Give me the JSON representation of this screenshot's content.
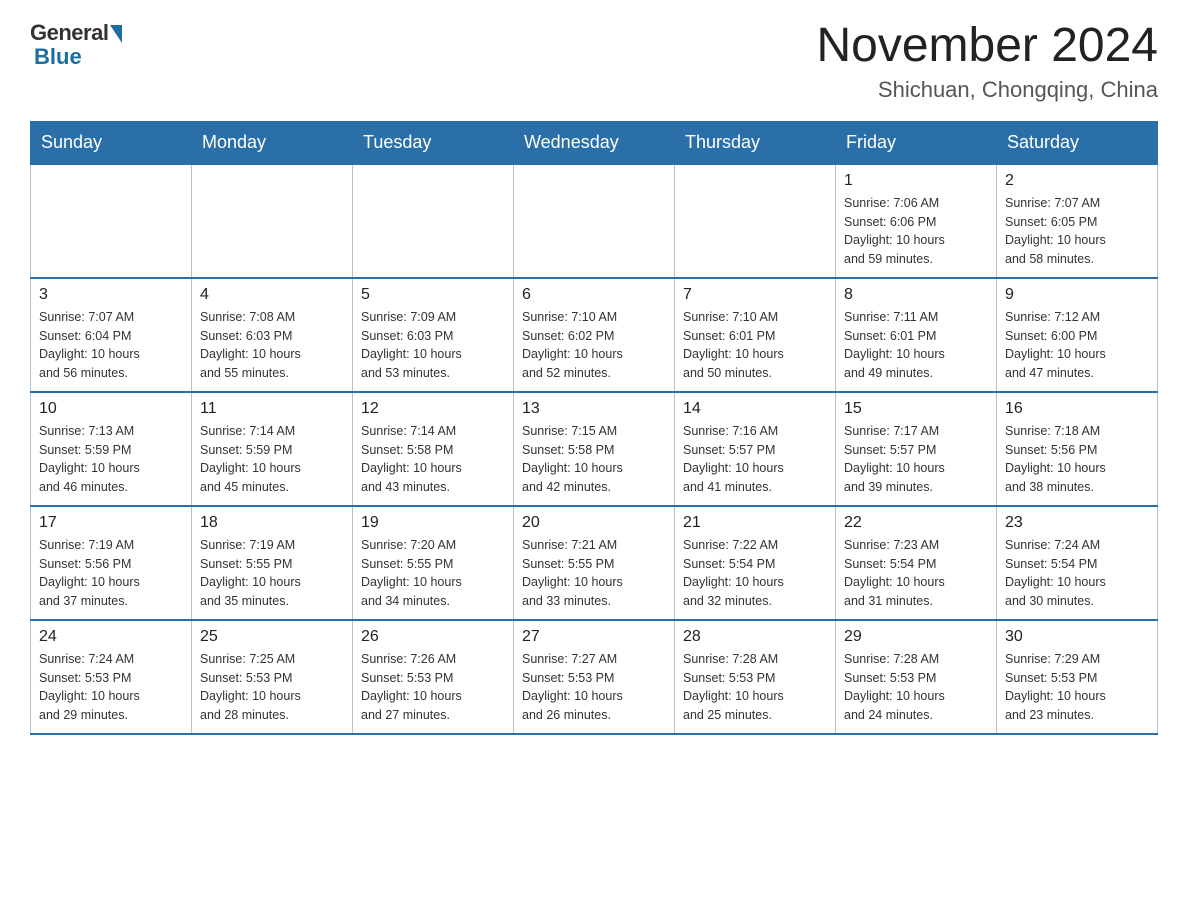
{
  "logo": {
    "general": "General",
    "blue": "Blue"
  },
  "header": {
    "title": "November 2024",
    "location": "Shichuan, Chongqing, China"
  },
  "days_of_week": [
    "Sunday",
    "Monday",
    "Tuesday",
    "Wednesday",
    "Thursday",
    "Friday",
    "Saturday"
  ],
  "weeks": [
    [
      {
        "day": "",
        "info": ""
      },
      {
        "day": "",
        "info": ""
      },
      {
        "day": "",
        "info": ""
      },
      {
        "day": "",
        "info": ""
      },
      {
        "day": "",
        "info": ""
      },
      {
        "day": "1",
        "info": "Sunrise: 7:06 AM\nSunset: 6:06 PM\nDaylight: 10 hours\nand 59 minutes."
      },
      {
        "day": "2",
        "info": "Sunrise: 7:07 AM\nSunset: 6:05 PM\nDaylight: 10 hours\nand 58 minutes."
      }
    ],
    [
      {
        "day": "3",
        "info": "Sunrise: 7:07 AM\nSunset: 6:04 PM\nDaylight: 10 hours\nand 56 minutes."
      },
      {
        "day": "4",
        "info": "Sunrise: 7:08 AM\nSunset: 6:03 PM\nDaylight: 10 hours\nand 55 minutes."
      },
      {
        "day": "5",
        "info": "Sunrise: 7:09 AM\nSunset: 6:03 PM\nDaylight: 10 hours\nand 53 minutes."
      },
      {
        "day": "6",
        "info": "Sunrise: 7:10 AM\nSunset: 6:02 PM\nDaylight: 10 hours\nand 52 minutes."
      },
      {
        "day": "7",
        "info": "Sunrise: 7:10 AM\nSunset: 6:01 PM\nDaylight: 10 hours\nand 50 minutes."
      },
      {
        "day": "8",
        "info": "Sunrise: 7:11 AM\nSunset: 6:01 PM\nDaylight: 10 hours\nand 49 minutes."
      },
      {
        "day": "9",
        "info": "Sunrise: 7:12 AM\nSunset: 6:00 PM\nDaylight: 10 hours\nand 47 minutes."
      }
    ],
    [
      {
        "day": "10",
        "info": "Sunrise: 7:13 AM\nSunset: 5:59 PM\nDaylight: 10 hours\nand 46 minutes."
      },
      {
        "day": "11",
        "info": "Sunrise: 7:14 AM\nSunset: 5:59 PM\nDaylight: 10 hours\nand 45 minutes."
      },
      {
        "day": "12",
        "info": "Sunrise: 7:14 AM\nSunset: 5:58 PM\nDaylight: 10 hours\nand 43 minutes."
      },
      {
        "day": "13",
        "info": "Sunrise: 7:15 AM\nSunset: 5:58 PM\nDaylight: 10 hours\nand 42 minutes."
      },
      {
        "day": "14",
        "info": "Sunrise: 7:16 AM\nSunset: 5:57 PM\nDaylight: 10 hours\nand 41 minutes."
      },
      {
        "day": "15",
        "info": "Sunrise: 7:17 AM\nSunset: 5:57 PM\nDaylight: 10 hours\nand 39 minutes."
      },
      {
        "day": "16",
        "info": "Sunrise: 7:18 AM\nSunset: 5:56 PM\nDaylight: 10 hours\nand 38 minutes."
      }
    ],
    [
      {
        "day": "17",
        "info": "Sunrise: 7:19 AM\nSunset: 5:56 PM\nDaylight: 10 hours\nand 37 minutes."
      },
      {
        "day": "18",
        "info": "Sunrise: 7:19 AM\nSunset: 5:55 PM\nDaylight: 10 hours\nand 35 minutes."
      },
      {
        "day": "19",
        "info": "Sunrise: 7:20 AM\nSunset: 5:55 PM\nDaylight: 10 hours\nand 34 minutes."
      },
      {
        "day": "20",
        "info": "Sunrise: 7:21 AM\nSunset: 5:55 PM\nDaylight: 10 hours\nand 33 minutes."
      },
      {
        "day": "21",
        "info": "Sunrise: 7:22 AM\nSunset: 5:54 PM\nDaylight: 10 hours\nand 32 minutes."
      },
      {
        "day": "22",
        "info": "Sunrise: 7:23 AM\nSunset: 5:54 PM\nDaylight: 10 hours\nand 31 minutes."
      },
      {
        "day": "23",
        "info": "Sunrise: 7:24 AM\nSunset: 5:54 PM\nDaylight: 10 hours\nand 30 minutes."
      }
    ],
    [
      {
        "day": "24",
        "info": "Sunrise: 7:24 AM\nSunset: 5:53 PM\nDaylight: 10 hours\nand 29 minutes."
      },
      {
        "day": "25",
        "info": "Sunrise: 7:25 AM\nSunset: 5:53 PM\nDaylight: 10 hours\nand 28 minutes."
      },
      {
        "day": "26",
        "info": "Sunrise: 7:26 AM\nSunset: 5:53 PM\nDaylight: 10 hours\nand 27 minutes."
      },
      {
        "day": "27",
        "info": "Sunrise: 7:27 AM\nSunset: 5:53 PM\nDaylight: 10 hours\nand 26 minutes."
      },
      {
        "day": "28",
        "info": "Sunrise: 7:28 AM\nSunset: 5:53 PM\nDaylight: 10 hours\nand 25 minutes."
      },
      {
        "day": "29",
        "info": "Sunrise: 7:28 AM\nSunset: 5:53 PM\nDaylight: 10 hours\nand 24 minutes."
      },
      {
        "day": "30",
        "info": "Sunrise: 7:29 AM\nSunset: 5:53 PM\nDaylight: 10 hours\nand 23 minutes."
      }
    ]
  ]
}
